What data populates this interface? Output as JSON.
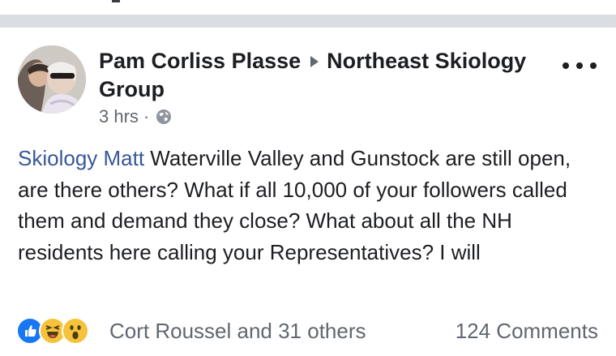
{
  "post": {
    "author": "Pam Corliss Plasse",
    "group": "Northeast Skiology Group",
    "time": "3 hrs",
    "separator": "·",
    "mention": "Skiology Matt",
    "body": " Waterville Valley and Gunstock are still open, are there others? What if all 10,000 of your followers called them and demand they close? What about all the NH residents here calling your Representatives? I will"
  },
  "reactions": {
    "icons": [
      "like-icon",
      "haha-icon",
      "wow-icon"
    ],
    "summary": "Cort Roussel and 31 others",
    "comments": "124 Comments"
  },
  "colors": {
    "mention": "#385898",
    "meta": "#606770",
    "like": "#1877f2",
    "divider": "#dadde1"
  }
}
